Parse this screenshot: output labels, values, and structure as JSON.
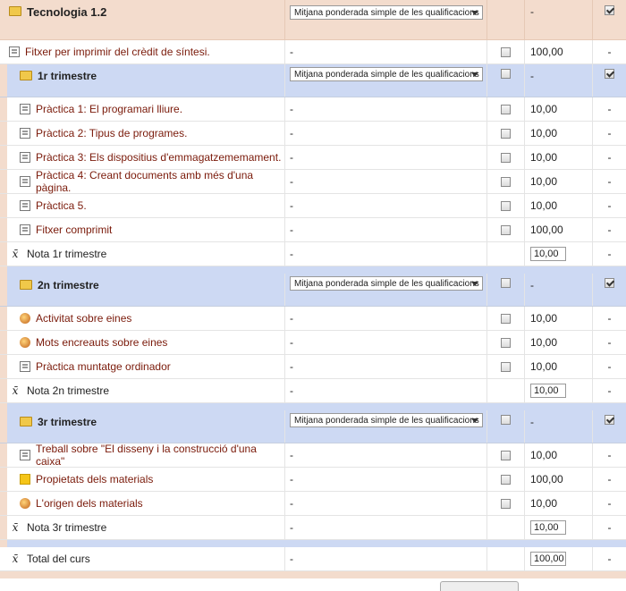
{
  "aggregation_label": "Mitjana ponderada simple de les qualificacions",
  "dash": "-",
  "rows": [
    {
      "kind": "cat-top",
      "name": "Tecnologia 1.2",
      "icon": "folder-icon",
      "value": "-",
      "hidden": null,
      "locked": true
    },
    {
      "kind": "item",
      "name": "Fitxer per imprimir del crèdit de síntesi.",
      "icon": "assignment-icon",
      "value": "100,00",
      "hidden": false,
      "indent": false
    },
    {
      "kind": "cat",
      "name": "1r trimestre",
      "icon": "folder-icon",
      "value": "-",
      "hidden": false,
      "locked": true
    },
    {
      "kind": "item",
      "name": "Pràctica 1: El programari lliure.",
      "icon": "assignment-icon",
      "value": "10,00",
      "hidden": false,
      "indent": true
    },
    {
      "kind": "item",
      "name": "Pràctica 2: Tipus de programes.",
      "icon": "assignment-icon",
      "value": "10,00",
      "hidden": false,
      "indent": true
    },
    {
      "kind": "item",
      "name": "Pràctica 3: Els dispositius d'emmagatzememament.",
      "icon": "assignment-icon",
      "value": "10,00",
      "hidden": false,
      "indent": true
    },
    {
      "kind": "item",
      "name": "Pràctica 4: Creant documents amb més d'una pàgina.",
      "icon": "assignment-icon",
      "value": "10,00",
      "hidden": false,
      "indent": true
    },
    {
      "kind": "item",
      "name": "Pràctica 5.",
      "icon": "assignment-icon",
      "value": "10,00",
      "hidden": false,
      "indent": true
    },
    {
      "kind": "item",
      "name": "Fitxer comprimit",
      "icon": "assignment-icon",
      "value": "100,00",
      "hidden": false,
      "indent": true
    },
    {
      "kind": "total",
      "name": "Nota 1r trimestre",
      "icon": "mean-icon",
      "value": "10,00",
      "indent": true
    },
    {
      "kind": "spacer"
    },
    {
      "kind": "cat",
      "name": "2n trimestre",
      "icon": "folder-icon",
      "value": "-",
      "hidden": false,
      "locked": true
    },
    {
      "kind": "item",
      "name": "Activitat sobre eines",
      "icon": "quiz-icon",
      "value": "10,00",
      "hidden": false,
      "indent": true
    },
    {
      "kind": "item",
      "name": "Mots encreauts sobre eines",
      "icon": "quiz-icon",
      "value": "10,00",
      "hidden": false,
      "indent": true
    },
    {
      "kind": "item",
      "name": "Pràctica muntatge ordinador",
      "icon": "assignment-icon",
      "value": "10,00",
      "hidden": false,
      "indent": true
    },
    {
      "kind": "total",
      "name": "Nota 2n trimestre",
      "icon": "mean-icon",
      "value": "10,00",
      "indent": true
    },
    {
      "kind": "spacer"
    },
    {
      "kind": "cat",
      "name": "3r trimestre",
      "icon": "folder-icon",
      "value": "-",
      "hidden": false,
      "locked": true
    },
    {
      "kind": "item",
      "name": "Treball sobre \"El disseny i la construcció d'una caixa\"",
      "icon": "assignment-icon",
      "value": "10,00",
      "hidden": false,
      "indent": true
    },
    {
      "kind": "item",
      "name": "Propietats dels materials",
      "icon": "resource-icon",
      "value": "100,00",
      "hidden": false,
      "indent": true
    },
    {
      "kind": "item",
      "name": "L'origen dels materials",
      "icon": "quiz-icon",
      "value": "10,00",
      "hidden": false,
      "indent": true
    },
    {
      "kind": "total",
      "name": "Nota 3r trimestre",
      "icon": "mean-icon",
      "value": "10,00",
      "indent": true
    },
    {
      "kind": "spacer"
    },
    {
      "kind": "total",
      "name": "Total del curs",
      "icon": "mean-icon",
      "value": "100,00",
      "indent": false,
      "course": true
    },
    {
      "kind": "spacer2"
    }
  ]
}
